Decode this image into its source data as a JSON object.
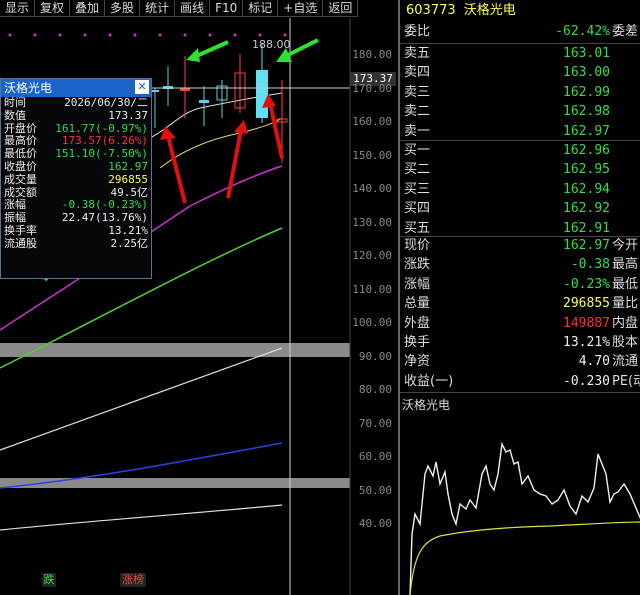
{
  "toolbar": [
    "显示",
    "复权",
    "叠加",
    "多股",
    "统计",
    "画线",
    "F10",
    "标记",
    "+自选",
    "返回"
  ],
  "chart": {
    "y_ticks": [
      "180.00",
      "170.00",
      "160.00",
      "150.00",
      "140.00",
      "130.00",
      "120.00",
      "110.00",
      "100.00",
      "90.00",
      "80.00",
      "70.00",
      "60.00",
      "50.00",
      "40.00"
    ],
    "high_label": "188.00",
    "cursor_price": "173.37",
    "badge_down": "跌",
    "badge_limit": "涨榜"
  },
  "popup": {
    "title": "沃格光电",
    "rows": [
      {
        "k": "时间",
        "v": "2026/06/30/二",
        "c": "white"
      },
      {
        "k": "数值",
        "v": "173.37",
        "c": "white"
      },
      {
        "k": "开盘价",
        "v": "161.77(-0.97%)",
        "c": "green"
      },
      {
        "k": "最高价",
        "v": "173.57(6.26%)",
        "c": "red"
      },
      {
        "k": "最低价",
        "v": "151.10(-7.50%)",
        "c": "green"
      },
      {
        "k": "收盘价",
        "v": "162.97",
        "c": "green"
      },
      {
        "k": "成交量",
        "v": "296855",
        "c": "yellow"
      },
      {
        "k": "成交额",
        "v": "49.5亿",
        "c": "white"
      },
      {
        "k": "涨幅",
        "v": "-0.38(-0.23%)",
        "c": "green"
      },
      {
        "k": "振幅",
        "v": "22.47(13.76%)",
        "c": "white"
      },
      {
        "k": "换手率",
        "v": "13.21%",
        "c": "white"
      },
      {
        "k": "流通股",
        "v": "2.25亿",
        "c": "white"
      }
    ]
  },
  "quote": {
    "code": "603773",
    "name": "沃格光电",
    "webi_label": "委比",
    "webi_value": "-62.42%",
    "weicha_label": "委差",
    "asks": [
      {
        "k": "卖五",
        "v": "163.01"
      },
      {
        "k": "卖四",
        "v": "163.00"
      },
      {
        "k": "卖三",
        "v": "162.99"
      },
      {
        "k": "卖二",
        "v": "162.98"
      },
      {
        "k": "卖一",
        "v": "162.97"
      }
    ],
    "bids": [
      {
        "k": "买一",
        "v": "162.96"
      },
      {
        "k": "买二",
        "v": "162.95"
      },
      {
        "k": "买三",
        "v": "162.94"
      },
      {
        "k": "买四",
        "v": "162.92"
      },
      {
        "k": "买五",
        "v": "162.91"
      }
    ],
    "stats": [
      {
        "k": "现价",
        "v": "162.97",
        "c": "green",
        "k2": "今开"
      },
      {
        "k": "涨跌",
        "v": "-0.38",
        "c": "green",
        "k2": "最高"
      },
      {
        "k": "涨幅",
        "v": "-0.23%",
        "c": "green",
        "k2": "最低"
      },
      {
        "k": "总量",
        "v": "296855",
        "c": "yellow",
        "k2": "量比"
      },
      {
        "k": "外盘",
        "v": "149887",
        "c": "red",
        "k2": "内盘"
      },
      {
        "k": "换手",
        "v": "13.21%",
        "c": "white",
        "k2": "股本"
      },
      {
        "k": "净资",
        "v": "4.70",
        "c": "white",
        "k2": "流通"
      },
      {
        "k": "收益(一)",
        "v": "-0.230",
        "c": "white",
        "k2": "PE(动"
      }
    ],
    "mini_title": "沃格光电"
  }
}
